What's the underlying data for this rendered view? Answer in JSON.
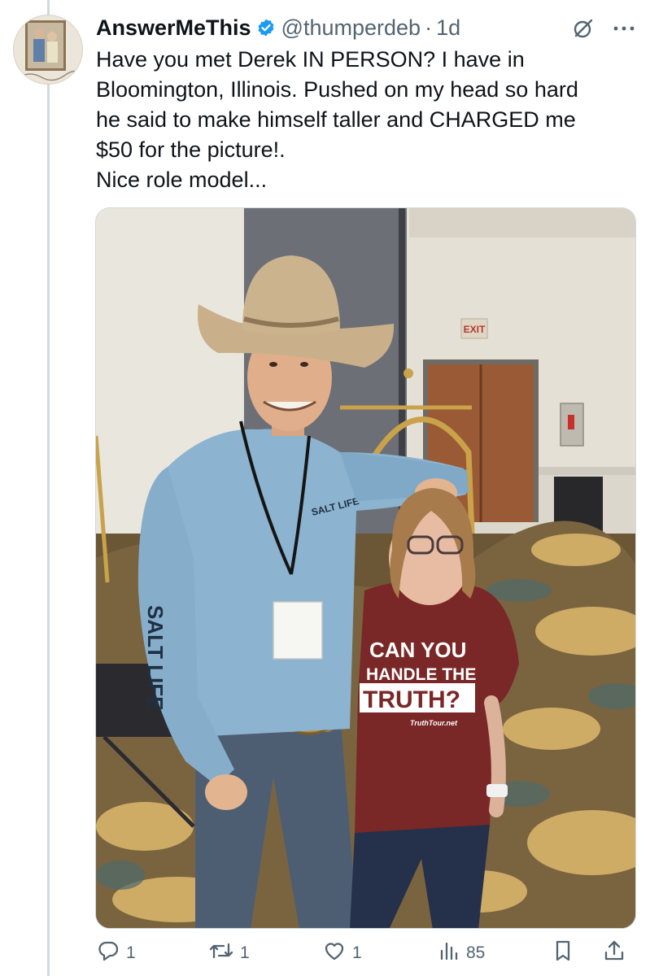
{
  "tweet": {
    "display_name": "AnswerMeThis",
    "handle": "@thumperdeb",
    "separator": "·",
    "time": "1d",
    "lines": [
      "Have you met Derek IN PERSON? I have in",
      "Bloomington, Illinois. Pushed on my head so hard",
      "he said to make himself taller and CHARGED me",
      "$50 for the picture!.",
      "Nice role model..."
    ]
  },
  "photo": {
    "exit_sign": "EXIT",
    "shirt_brand": "SALT LIFE",
    "sleeve_text": "SALT LIFE",
    "tshirt_lines": [
      "CAN YOU",
      "HANDLE THE",
      "TRUTH?"
    ],
    "tshirt_small": "TruthTour.net"
  },
  "actions": {
    "replies": "1",
    "reposts": "1",
    "likes": "1",
    "views": "85"
  },
  "icons": {
    "verified": "verified-badge-icon",
    "grok": "grok-icon",
    "more": "more-options-icon",
    "reply": "reply-icon",
    "repost": "repost-icon",
    "like": "heart-icon",
    "views": "views-chart-icon",
    "bookmark": "bookmark-icon",
    "share": "share-icon"
  },
  "colors": {
    "accent": "#1d9bf0",
    "text_primary": "#0f1419",
    "text_secondary": "#536471"
  }
}
